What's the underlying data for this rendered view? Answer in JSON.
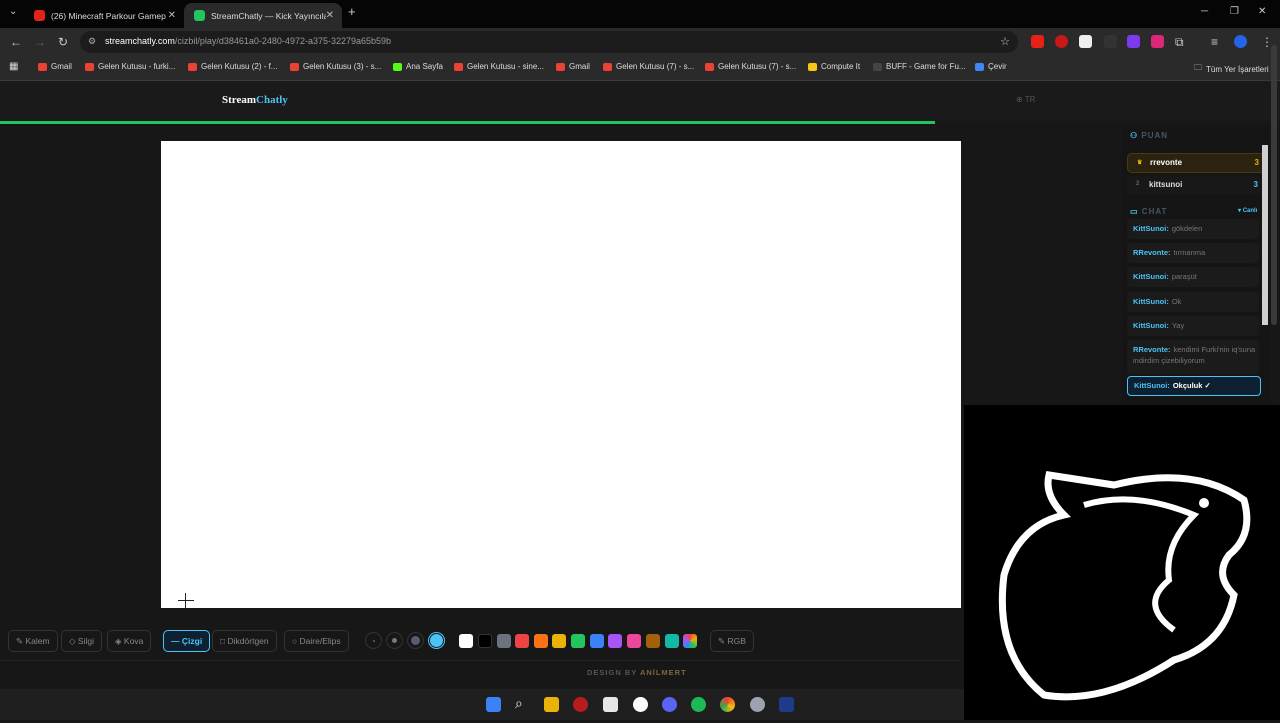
{
  "browser": {
    "tabs": [
      {
        "title": "(26) Minecraft Parkour Gameplay",
        "active": false,
        "color": "#e62117"
      },
      {
        "title": "StreamChatly — Kick Yayıncıları",
        "active": true,
        "color": "#22c55e"
      }
    ],
    "url_host": "streamchatly.com",
    "url_path": "/cizbil/play/d38461a0-2480-4972-a375-32279a65b59b",
    "bookmarks": [
      {
        "label": "Gmail",
        "color": "#ea4335"
      },
      {
        "label": "Gelen Kutusu - furki...",
        "color": "#ea4335"
      },
      {
        "label": "Gelen Kutusu (2) - f...",
        "color": "#ea4335"
      },
      {
        "label": "Gelen Kutusu (3) - s...",
        "color": "#ea4335"
      },
      {
        "label": "Ana Sayfa",
        "color": "#53fc18"
      },
      {
        "label": "Gelen Kutusu - sine...",
        "color": "#ea4335"
      },
      {
        "label": "Gmail",
        "color": "#ea4335"
      },
      {
        "label": "Gelen Kutusu (7) - s...",
        "color": "#ea4335"
      },
      {
        "label": "Gelen Kutusu (7) - s...",
        "color": "#ea4335"
      },
      {
        "label": "Compute It",
        "color": "#f5c518"
      },
      {
        "label": "BUFF - Game for Fu...",
        "color": "#333333"
      },
      {
        "label": "Çevir",
        "color": "#4285f4"
      }
    ],
    "all_bookmarks": "Tüm Yer İşaretleri"
  },
  "site": {
    "logo_a": "Stream",
    "logo_b": "Chatly",
    "lang": "TR",
    "progress": 0.73
  },
  "scoreboard": {
    "header": "PUAN",
    "players": [
      {
        "rank": "♛",
        "name": "rrevonte",
        "score": "3",
        "highlight": true
      },
      {
        "rank": "2",
        "name": "kittsunoi",
        "score": "3",
        "highlight": false
      }
    ]
  },
  "chat": {
    "header": "CHAT",
    "live": "Canlı",
    "messages": [
      {
        "user": "KittSunoi:",
        "text": "gökdelen",
        "color": "#4cc3f5"
      },
      {
        "user": "RRevonte:",
        "text": "tırmanma",
        "color": "#4cc3f5"
      },
      {
        "user": "KittSunoi:",
        "text": "paraşüt",
        "color": "#4cc3f5"
      },
      {
        "user": "KittSunoi:",
        "text": "Ok",
        "color": "#4cc3f5"
      },
      {
        "user": "KittSunoi:",
        "text": "Yay",
        "color": "#4cc3f5"
      },
      {
        "user": "RRevonte:",
        "text": "kendimi Furki'nin iq'suna indirdim çizebiliyorum",
        "color": "#4cc3f5"
      },
      {
        "user": "KittSunoi:",
        "text": "Okçuluk ✓",
        "color": "#4cc3f5"
      }
    ]
  },
  "tools": {
    "pen": "Kalem",
    "eraser": "Silgi",
    "bucket": "Kova",
    "line": "Çizgi",
    "rect": "Dikdörtgen",
    "ellipse": "Daire/Elips",
    "rgb": "RGB",
    "colors": [
      "#ffffff",
      "#000000",
      "#6b7280",
      "#ef4444",
      "#f97316",
      "#eab308",
      "#22c55e",
      "#3b82f6",
      "#a855f7",
      "#ec4899",
      "#a16207",
      "#14b8a6"
    ],
    "active_tool": "line",
    "size_active": "#4cc3f5"
  },
  "footer": {
    "design": "DESIGN BY",
    "author": "ANİLMERT"
  }
}
